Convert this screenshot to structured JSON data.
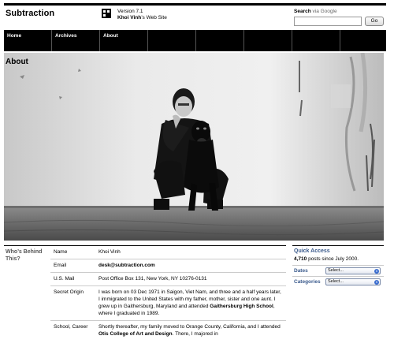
{
  "header": {
    "site_title": "Subtraction",
    "version": "Version 7.1",
    "author_bold": "Khoi Vinh",
    "author_suffix": "’s Web Site"
  },
  "search": {
    "label_bold": "Search",
    "label_suffix": " via Google",
    "value": "",
    "go_label": "Go"
  },
  "nav": {
    "items": [
      {
        "label": "Home"
      },
      {
        "label": "Archives"
      },
      {
        "label": "About"
      }
    ]
  },
  "page": {
    "title": "About",
    "hero_alt": "Photo of Khoi Vinh with a dog"
  },
  "bio": {
    "section_label": "Who’s Behind This?",
    "rows": [
      {
        "key": "Name",
        "value": "Khoi Vinh"
      },
      {
        "key": "Email",
        "value": "desk@subtraction.com"
      },
      {
        "key": "U.S. Mail",
        "value": "Post Office Box 131, New York, NY 10276-0131"
      },
      {
        "key": "Secret Origin",
        "value_pre": "I was born on 03 Dec 1971 in Saigon, Viet Nam, and three and a half years later, I immigrated to the United States with my father, mother, sister and one aunt. I grew up in Gaithersburg, Maryland and attended ",
        "value_bold": "Gaithersburg High School",
        "value_post": ", where I graduated in 1989."
      },
      {
        "key": "School, Career",
        "value_pre": "Shortly thereafter, my family moved to Orange County, California, and I attended ",
        "value_bold": "Otis College of Art and Design",
        "value_post": ". There, I majored in"
      }
    ]
  },
  "quick_access": {
    "title": "Quick Access",
    "count": "4,710",
    "count_suffix": " posts since July 2000.",
    "dates_label": "Dates",
    "dates_value": "Select...",
    "categories_label": "Categories",
    "categories_value": "Select..."
  },
  "colors": {
    "accent_link": "#3a5a8c",
    "nav_bg": "#000000"
  }
}
